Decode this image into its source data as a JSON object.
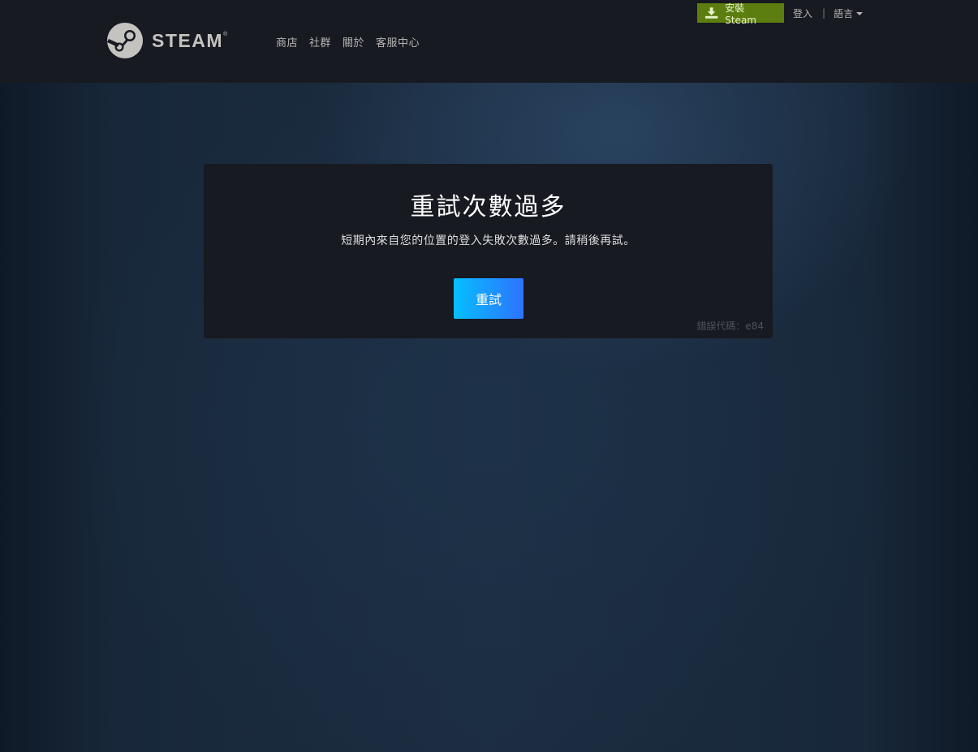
{
  "header": {
    "logo_text": "STEAM",
    "logo_reg": "®",
    "nav": [
      "商店",
      "社群",
      "關於",
      "客服中心"
    ],
    "install_label": "安裝 Steam",
    "login_label": "登入",
    "separator": "|",
    "language_label": "語言"
  },
  "error": {
    "title": "重試次數過多",
    "message": "短期內來自您的位置的登入失敗次數過多。請稍後再試。",
    "retry_label": "重試",
    "code_label": "錯誤代碼：e84"
  },
  "colors": {
    "header_bg": "#171a21",
    "install_green": "#5c7e10",
    "retry_gradient_start": "#06bfff",
    "retry_gradient_end": "#2d73ff",
    "box_bg": "#181a21"
  }
}
